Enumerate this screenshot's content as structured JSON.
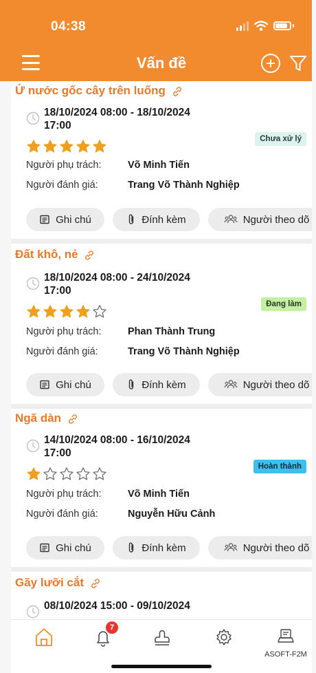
{
  "status_bar": {
    "time": "04:38"
  },
  "header": {
    "title": "Vấn đề"
  },
  "labels": {
    "assignee": "Người phụ trách:",
    "reviewer": "Người đánh giá:",
    "note": "Ghi chú",
    "attach": "Đính kèm",
    "follow": "Người theo dõ"
  },
  "issues": [
    {
      "title": "Ứ nước gốc cây trên luống",
      "date_line1": "18/10/2024 08:00 - 18/10/2024",
      "date_line2": "17:00",
      "rating": 5,
      "status": "Chưa xử lý",
      "assignee": "Võ Minh Tiến",
      "reviewer": "Trang Võ Thành Nghiệp"
    },
    {
      "title": "Đất khô, nẻ",
      "date_line1": "18/10/2024 08:00 - 24/10/2024",
      "date_line2": "17:00",
      "rating": 4,
      "status": "Đang làm",
      "assignee": "Phan Thành Trung",
      "reviewer": "Trang Võ Thành Nghiệp"
    },
    {
      "title": "Ngã dàn",
      "date_line1": "14/10/2024 08:00 - 16/10/2024",
      "date_line2": "17:00",
      "rating": 1,
      "status": "Hoàn thành",
      "assignee": "Võ Minh Tiến",
      "reviewer": "Nguyễn Hữu Cảnh"
    },
    {
      "title": "Gãy lưỡi cắt",
      "date_line1": "08/10/2024 15:00 - 09/10/2024",
      "date_line2": ""
    }
  ],
  "tabbar": {
    "notification_count": "7",
    "account_label": "ASOFT-F2M"
  },
  "colors": {
    "brand": "#f28a2e",
    "title": "#e9792a",
    "star": "#f0a020"
  }
}
